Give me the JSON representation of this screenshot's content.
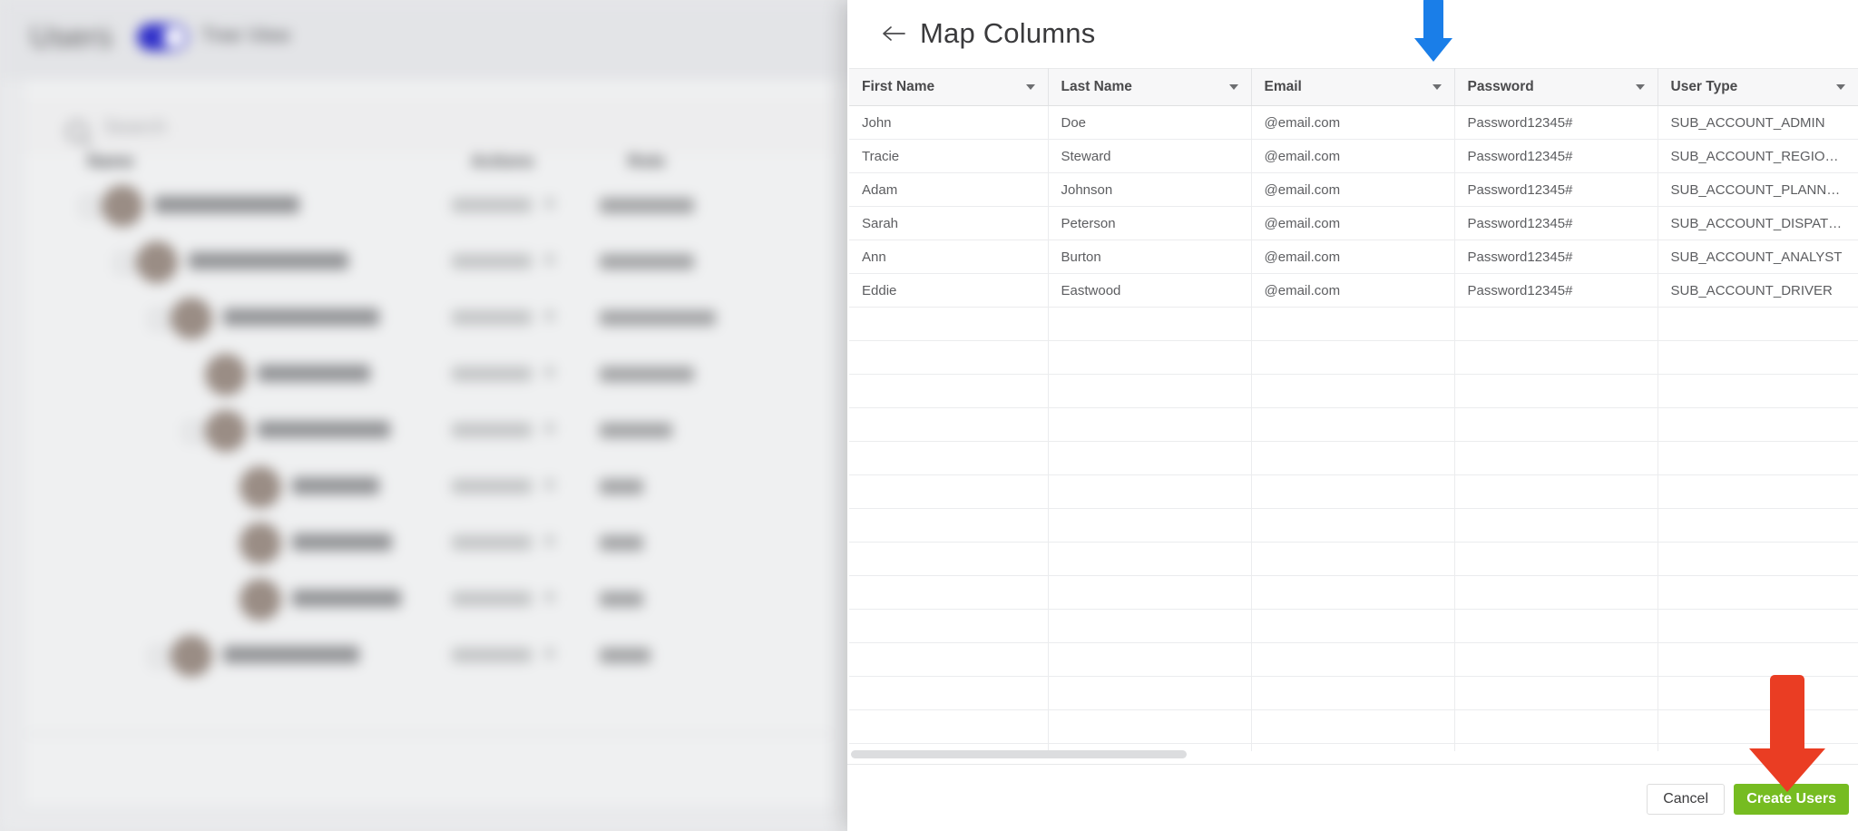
{
  "background": {
    "page_title": "Users",
    "toggle_label": "Tree View",
    "toggle_on": true,
    "search_placeholder": "Search",
    "columns": [
      "Name",
      "Actions",
      "Role"
    ],
    "rows": [
      {
        "name": "Robert Jones",
        "indent": 0,
        "action": "Add User",
        "role": "Account Owner"
      },
      {
        "name": "Mary Davidson",
        "indent": 1,
        "action": "Add User",
        "role": "Administrator"
      },
      {
        "name": "Kevin Williams",
        "indent": 2,
        "action": "Add User",
        "role": "Regional Manager"
      },
      {
        "name": "Brian Green",
        "indent": 3,
        "action": "Add User",
        "role": "Route Planner"
      },
      {
        "name": "Sarah Hughes",
        "indent": 3,
        "action": "Add User",
        "role": "Dispatcher"
      },
      {
        "name": "Cyd Miller",
        "indent": 4,
        "action": "Add User",
        "role": "Driver"
      },
      {
        "name": "Frank Webb",
        "indent": 4,
        "action": "Add User",
        "role": "Driver"
      },
      {
        "name": "John Collins",
        "indent": 4,
        "action": "Add User",
        "role": "Driver"
      },
      {
        "name": "Trevor Clarkson",
        "indent": 2,
        "action": "Add User",
        "role": "Analyst"
      }
    ]
  },
  "panel": {
    "title": "Map Columns",
    "back_icon": "arrow-left-icon",
    "table": {
      "headers": [
        "First Name",
        "Last Name",
        "Email",
        "Password",
        "User Type"
      ],
      "header_caret_icon": "chevron-down-icon",
      "rows": [
        [
          "John",
          "Doe",
          "@email.com",
          "Password12345#",
          "SUB_ACCOUNT_ADMIN"
        ],
        [
          "Tracie",
          "Steward",
          "@email.com",
          "Password12345#",
          "SUB_ACCOUNT_REGIONA..."
        ],
        [
          "Adam",
          "Johnson",
          "@email.com",
          "Password12345#",
          "SUB_ACCOUNT_PLANNER"
        ],
        [
          "Sarah",
          "Peterson",
          "@email.com",
          "Password12345#",
          "SUB_ACCOUNT_DISPATC..."
        ],
        [
          "Ann",
          "Burton",
          "@email.com",
          "Password12345#",
          "SUB_ACCOUNT_ANALYST"
        ],
        [
          "Eddie",
          "Eastwood",
          "@email.com",
          "Password12345#",
          "SUB_ACCOUNT_DRIVER"
        ]
      ],
      "empty_row_count": 14
    },
    "scrollbar": {
      "orientation": "horizontal",
      "thumb_fraction": 0.33
    },
    "footer": {
      "cancel_label": "Cancel",
      "create_label": "Create Users",
      "create_color": "#76bc21"
    }
  },
  "annotations": [
    {
      "name": "blue-arrow",
      "color": "#1a7ee8",
      "points_to": "email-column-header-caret"
    },
    {
      "name": "red-arrow",
      "color": "#ea3d23",
      "points_to": "create-users-button"
    }
  ]
}
